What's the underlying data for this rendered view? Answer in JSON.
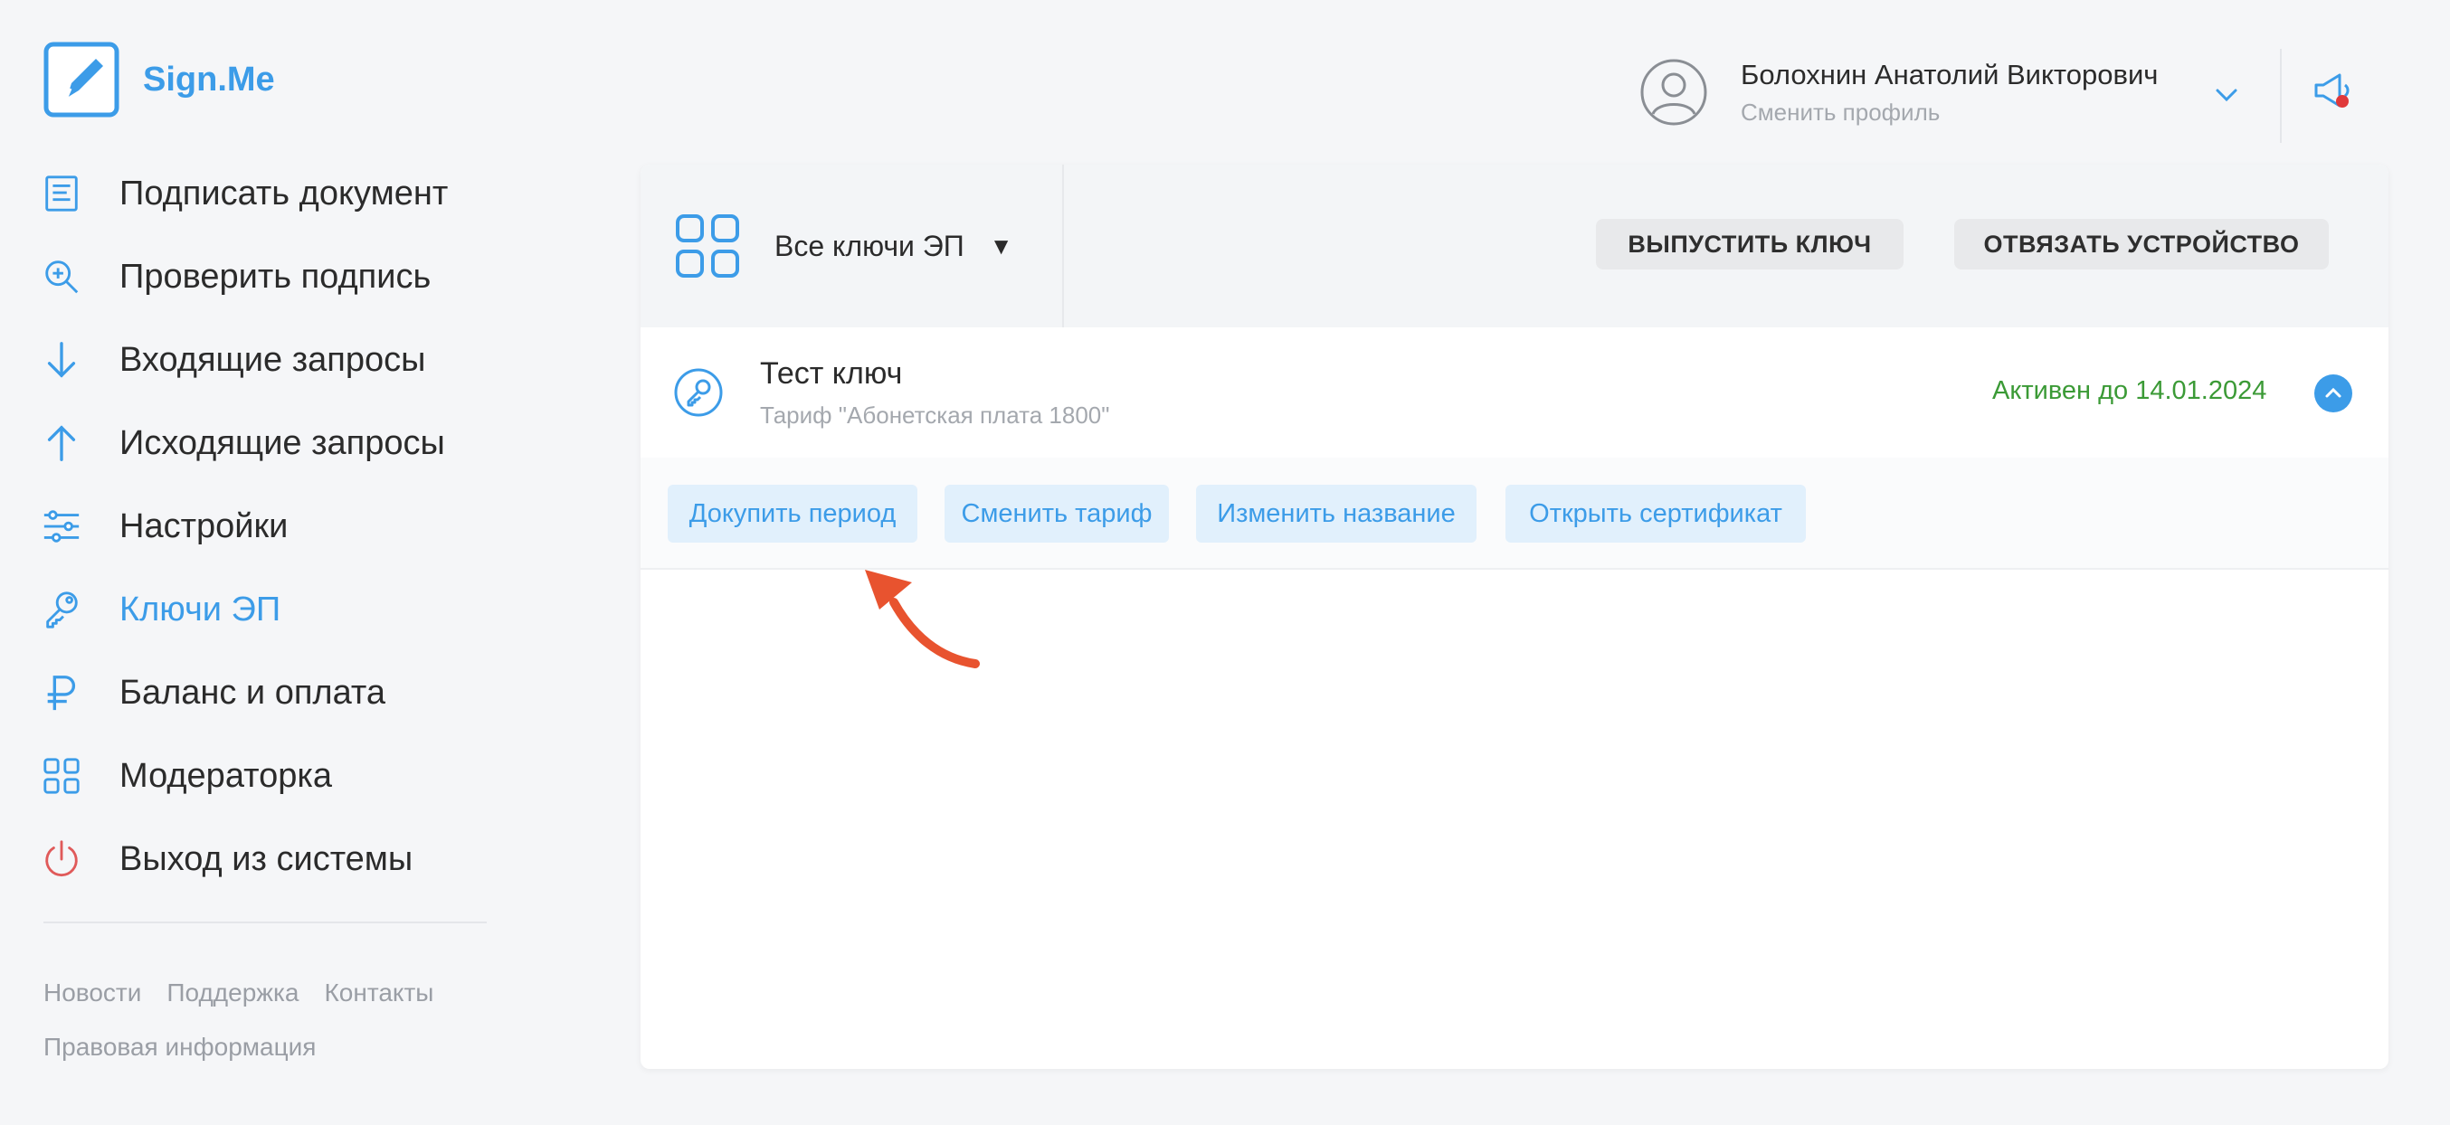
{
  "app": {
    "logo_text": "Sign.Me",
    "accent": "#3c9ce8"
  },
  "sidebar": {
    "items": [
      {
        "label": "Подписать документ",
        "icon": "document-icon"
      },
      {
        "label": "Проверить подпись",
        "icon": "zoom-in-icon"
      },
      {
        "label": "Входящие запросы",
        "icon": "arrow-down-icon"
      },
      {
        "label": "Исходящие запросы",
        "icon": "arrow-up-icon"
      },
      {
        "label": "Настройки",
        "icon": "sliders-icon"
      },
      {
        "label": "Ключи ЭП",
        "icon": "key-icon",
        "active": true
      },
      {
        "label": "Баланс и оплата",
        "icon": "ruble-icon"
      },
      {
        "label": "Модераторка",
        "icon": "grid-icon"
      },
      {
        "label": "Выход из системы",
        "icon": "power-icon"
      }
    ],
    "footer": {
      "news": "Новости",
      "support": "Поддержка",
      "contacts": "Контакты",
      "legal": "Правовая информация"
    }
  },
  "header": {
    "user_name": "Болохнин Анатолий Викторович",
    "switch_profile": "Сменить профиль"
  },
  "toolbar": {
    "filter_label": "Все ключи ЭП",
    "filter_caret": "▼",
    "issue_key": "ВЫПУСТИТЬ КЛЮЧ",
    "unbind_device": "ОТВЯЗАТЬ УСТРОЙСТВО"
  },
  "key": {
    "name": "Тест ключ",
    "tariff": "Тариф \"Абонетская плата 1800\"",
    "status": "Активен до 14.01.2024",
    "status_color": "#3b9a36"
  },
  "actions": {
    "buy_period": "Докупить период",
    "change_tariff": "Сменить тариф",
    "rename": "Изменить название",
    "open_certificate": "Открыть сертификат"
  },
  "annotation": {
    "arrow_color": "#e8532f"
  }
}
